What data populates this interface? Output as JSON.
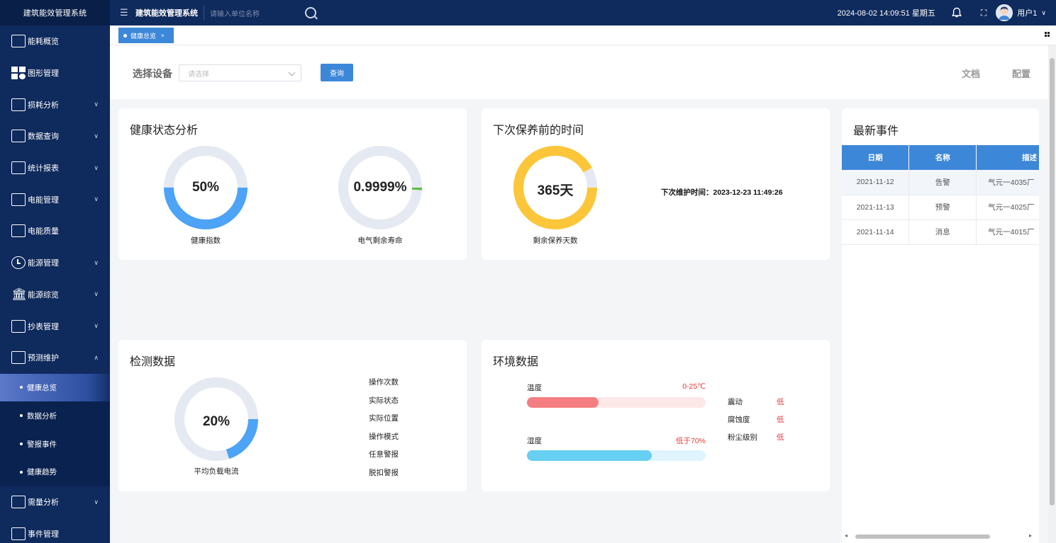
{
  "app": {
    "title": "建筑能效管理系统"
  },
  "topbar": {
    "title": "建筑能效管理系统",
    "search_placeholder": "请输入单位名称",
    "datetime": "2024-08-02 14:09:51 星期五",
    "user": "用户1"
  },
  "sidebar": {
    "items": [
      {
        "label": "能耗概览"
      },
      {
        "label": "图形管理"
      },
      {
        "label": "损耗分析"
      },
      {
        "label": "数据查询"
      },
      {
        "label": "统计报表"
      },
      {
        "label": "电能管理"
      },
      {
        "label": "电能质量"
      },
      {
        "label": "能源管理"
      },
      {
        "label": "能源综览"
      },
      {
        "label": "抄表管理"
      },
      {
        "label": "预测维护"
      }
    ],
    "subitems": [
      {
        "label": "健康总览",
        "active": true
      },
      {
        "label": "数据分析"
      },
      {
        "label": "警报事件"
      },
      {
        "label": "健康趋势"
      }
    ],
    "after": [
      {
        "label": "需量分析"
      },
      {
        "label": "事件管理"
      }
    ]
  },
  "tabs": [
    {
      "label": "健康总览",
      "close": "×"
    }
  ],
  "filter": {
    "label": "选择设备",
    "placeholder": "请选择",
    "query_button": "查询",
    "doc_link": "文档",
    "config_link": "配置"
  },
  "health": {
    "title": "健康状态分析",
    "index": {
      "value": "50%",
      "percent": 50,
      "caption": "健康指数",
      "color": "#4da3f5"
    },
    "life": {
      "value": "0.9999%",
      "percent": 0.9999,
      "caption": "电气剩余寿命",
      "color": "#5bbf3c"
    }
  },
  "maintenance": {
    "title": "下次保养前的时间",
    "days": {
      "value": "365天",
      "percent": 92,
      "caption": "剩余保养天数",
      "color": "#fcc63a"
    },
    "next_label": "下次维护时间：",
    "next_time": "2023-12-23 11:49:26"
  },
  "events": {
    "title": "最新事件",
    "columns": [
      "日期",
      "名称",
      "描述"
    ],
    "rows": [
      {
        "date": "2021-11-12",
        "name": "告警",
        "desc": "气元一4035厂"
      },
      {
        "date": "2021-11-13",
        "name": "预警",
        "desc": "气元一4025厂"
      },
      {
        "date": "2021-11-14",
        "name": "消息",
        "desc": "气元一4015厂"
      }
    ]
  },
  "detect": {
    "title": "检测数据",
    "current": {
      "value": "20%",
      "percent": 20,
      "caption": "平均负载电流",
      "color": "#4da3f5"
    },
    "items": [
      "操作次数",
      "实际状态",
      "实际位置",
      "操作模式",
      "任意警报",
      "脱扣警报"
    ]
  },
  "env": {
    "title": "环境数据",
    "temp": {
      "label": "温度",
      "value": "0-25℃",
      "fill": 0.4,
      "color": "#f47e82",
      "track": "#fde8e8"
    },
    "humid": {
      "label": "湿度",
      "value": "低于70%",
      "fill": 0.7,
      "color": "#66cff2",
      "track": "#dff4fc"
    },
    "levels": [
      {
        "label": "震动",
        "value": "低"
      },
      {
        "label": "腐蚀度",
        "value": "低"
      },
      {
        "label": "粉尘级别",
        "value": "低"
      }
    ]
  }
}
